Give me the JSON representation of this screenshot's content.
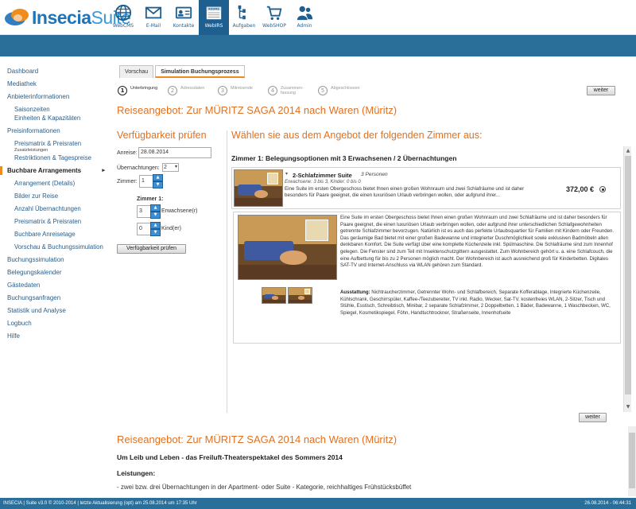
{
  "brand": {
    "part1": "Insecia",
    "part2": "Suite"
  },
  "topnav": [
    "WebCMS",
    "E-Mail",
    "Kontakte",
    "WebIRS",
    "Aufgaben",
    "WebSHOP",
    "Admin"
  ],
  "sidebar": {
    "items": [
      {
        "label": "Dashboard"
      },
      {
        "label": "Mediathek"
      },
      {
        "label": "Anbieterinformationen",
        "sub": [
          "Saisonzeiten",
          "Einheiten & Kapazitäten"
        ]
      },
      {
        "label": "Preisinformationen",
        "sub": [
          "Preismatrix & Preisraten",
          "Zusatzleistungen",
          "Restriktionen & Tagespreise"
        ]
      },
      {
        "label": "Buchbare Arrangements",
        "sub": [
          "Arrangement (Details)",
          "Bilder zur Reise",
          "Anzahl Übernachtungen",
          "Preismatrix & Preisraten",
          "Buchbare Anreisetage",
          "Vorschau & Buchungssimulation"
        ]
      },
      {
        "label": "Buchungssimulation"
      },
      {
        "label": "Belegungskalender"
      },
      {
        "label": "Gästedaten"
      },
      {
        "label": "Buchungsanfragen"
      },
      {
        "label": "Statistik und Analyse"
      },
      {
        "label": "Logbuch"
      },
      {
        "label": "Hilfe"
      }
    ]
  },
  "tabs": [
    "Vorschau",
    "Simulation Buchungsprozess"
  ],
  "steps": [
    {
      "num": "1",
      "label": "Unterbringung"
    },
    {
      "num": "2",
      "label": "Adressdaten"
    },
    {
      "num": "3",
      "label": "Mitreisende"
    },
    {
      "num": "4",
      "label": "Zusammen-\nfassung"
    },
    {
      "num": "5",
      "label": "Abgeschlossen"
    }
  ],
  "buttons": {
    "weiter": "weiter",
    "check": "Verfügbarkeit prüfen"
  },
  "heading": "Reiseangebot: Zur MÜRITZ SAGA 2014 nach Waren (Müritz)",
  "form": {
    "title": "Verfügbarkeit prüfen",
    "anreise_label": "Anreise:",
    "anreise_value": "28.08.2014",
    "nights_label": "Übernachtungen:",
    "nights_value": "2",
    "rooms_label": "Zimmer:",
    "rooms_value": "1",
    "room1_label": "Zimmer 1:",
    "adults_value": "3",
    "adults_label": "Erwachsene(r)",
    "kids_value": "0",
    "kids_label": "Kind(er)"
  },
  "offer": {
    "title": "Wählen sie aus dem Angebot der folgenden Zimmer aus:",
    "zimmer_title": "Zimmer 1: Belegungsoptionen mit 3 Erwachsenen / 2 Übernachtungen",
    "room_name": "2-Schlafzimmer Suite",
    "room_persons": "3 Personen",
    "room_occ": "Erwachsene: 3 bis 3, Kinder: 0 bis 0",
    "room_short": "Eine Suite im ersten Obergeschoss bietet Ihnen einen großen Wohnraum und zwei Schlafräume und ist daher besonders für Paare geeignet, die einen luxuriösen Urlaub verbringen wollen, oder aufgrund ihrer...",
    "price": "372,00 €",
    "detail_desc": "Eine Suite im ersten Obergeschoss bietet Ihnen einen großen Wohnraum und zwei Schlafräume und ist daher besonders für Paare geeignet, die einen luxuriösen Urlaub verbringen wollen, oder aufgrund ihrer unterschiedlichen Schlafgewohnheiten getrennte Schlafzimmer bevorzugen. Natürlich ist es auch das perfekte Urlaubsquartier für Familien mit Kindern oder Freunden. Das geräumige Bad bietet mit einer großen Badewanne und integrierter Duschmöglichkeit sowie exklusiven Badmöbeln allen denkbaren Komfort. Die Suite verfügt über eine komplette Küchenzeile inkl. Spülmaschine. Die Schlafräume sind zum Innenhof gelegen. Die Fenster sind zum Teil mit Insektenschutzgittern ausgestattet. Zum Wohnbereich gehört u. a. eine Schlafcouch, die eine Aufbettung für bis zu 2 Personen möglich macht. Der Wohnbereich ist auch ausreichend groß für Kinderbetten. Digitales SAT-TV und Internet-Anschluss via WLAN gehören zum Standard.",
    "amen_label": "Ausstattung:",
    "amen_text": "Nichtraucherzimmer, Getrennter Wohn- und Schlafbereich, Separate Kofferablage, Integrierte Küchenzeile, Kühlschrank, Geschirrspüler, Kaffee-/Teezubereiter, TV inkl. Radio, Wecker, Sat-TV, kostenfreies WLAN, 2-Sitzer, Tisch und Stühle, Esstisch, Schreibtisch, Minibar, 2 separate Schlafzimmer, 2 Doppelbetten, 1 Bäder, Badewanne, 1 Waschbecken, WC, Spiegel, Kosmetikspiegel, Föhn, Handtuchtrockner, Straßenseite, Innenhofseite"
  },
  "bottom": {
    "heading": "Reiseangebot: Zur MÜRITZ SAGA 2014 nach Waren (Müritz)",
    "subtitle": "Um Leib und Leben - das Freiluft-Theaterspektakel des Sommers 2014",
    "leistungen": "Leistungen:",
    "item": "- zwei bzw. drei Übernachtungen in der Apartment- oder Suite - Kategorie, reichhaltiges Frühstücksbüffet"
  },
  "footer": {
    "left": "INSECIA | Suite v3.0 © 2010-2014 | letzte Aktualisierung (opt) am 25.08.2014 um 17:35 Uhr",
    "right": "26.08.2014 - 06:44:31"
  },
  "colors": {
    "accent": "#e2701f",
    "nav_blue": "#2a6e9a",
    "link": "#2c5d86"
  }
}
